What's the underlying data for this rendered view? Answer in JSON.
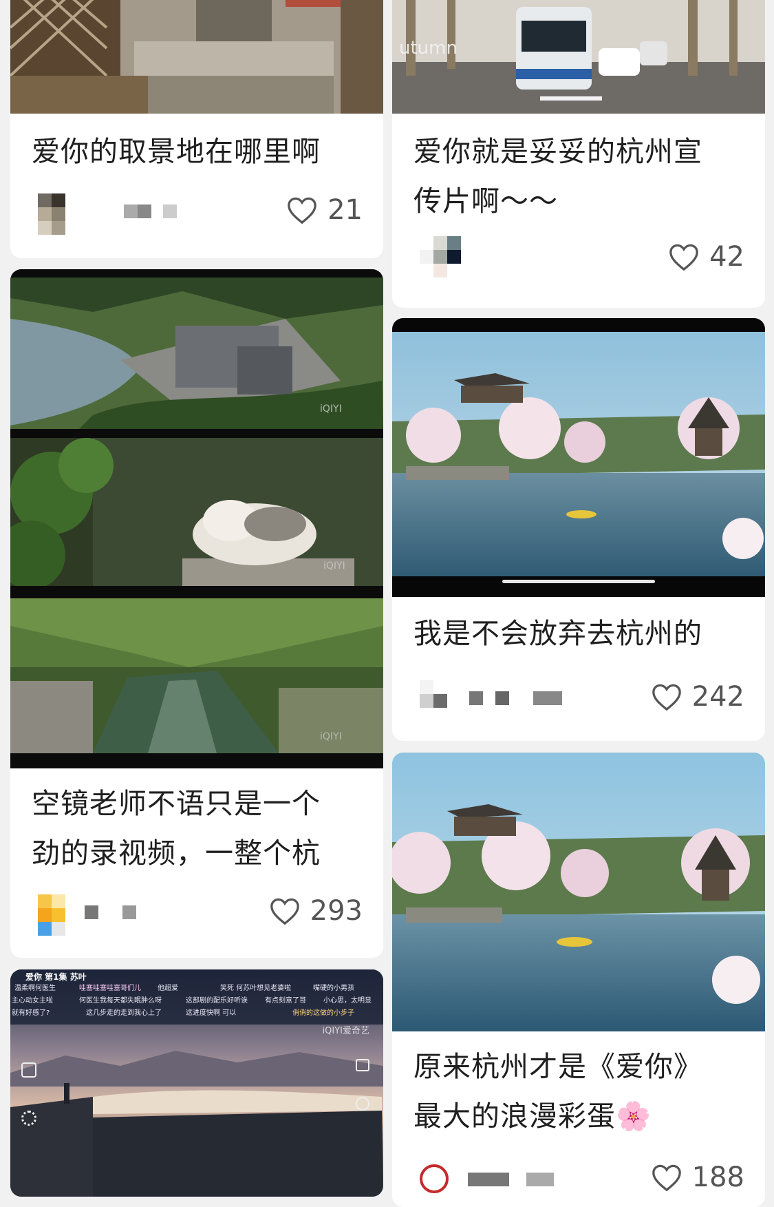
{
  "feed": {
    "cards": [
      {
        "id": "c1",
        "title": "爱你的取景地在哪里啊",
        "likes": "21"
      },
      {
        "id": "c2",
        "title": "爱你就是妥妥的杭州宣\n传片啊～～",
        "likes": "42"
      },
      {
        "id": "c3",
        "title": "空镜老师不语只是一个\n劲的录视频，一整个杭",
        "likes": "293"
      },
      {
        "id": "c4",
        "title": "我是不会放弃去杭州的",
        "likes": "242"
      },
      {
        "id": "c5",
        "title": "原来杭州才是《爱你》\n最大的浪漫彩蛋🌸",
        "likes": "188"
      }
    ]
  },
  "overlays": {
    "watermark": "iQIYI",
    "watermark_cn": "iQIYI爱奇艺",
    "bus_sign": "utumn",
    "player_header": "爱你 第1集 苏叶",
    "danmaku": [
      "温柔啊何医生",
      "哇塞哇塞哇塞哥们儿",
      "他超爱",
      "笑死 何苏叶想见老婆啦",
      "嘴硬的小男孩",
      "主心动女主啦",
      "何医生我每天都失眠肿么呀",
      "这部剧的配乐好听诶",
      "有点刻意了哥",
      "小心思，太明显",
      "就有好感了?",
      "这几步走的走到我心上了",
      "这进度快啊 可以",
      "俏俏的这做的小步子"
    ]
  },
  "colors": {
    "background": "#f1f1f1",
    "card": "#ffffff",
    "text": "#1f1f1f",
    "like": "#555555"
  },
  "icons": {
    "like": "heart-outline-icon"
  }
}
